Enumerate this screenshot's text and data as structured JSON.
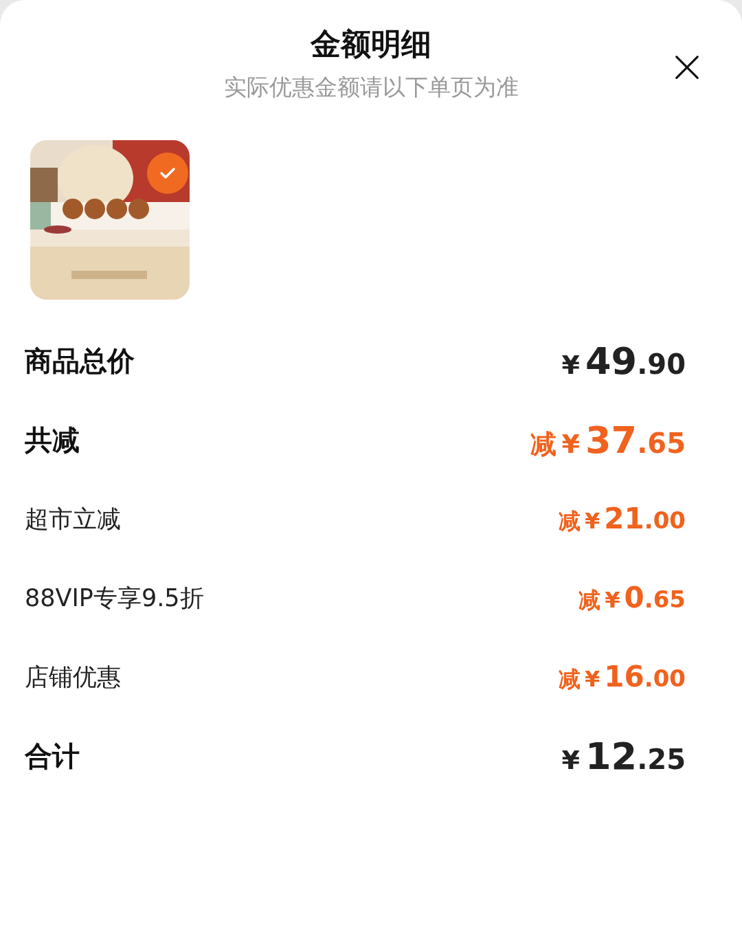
{
  "header": {
    "title": "金额明细",
    "subtitle": "实际优惠金额请以下单页为准"
  },
  "product": {
    "kind": "picture",
    "selected": true
  },
  "rows": [
    {
      "kind": "major",
      "label": "商品总价",
      "discount": false,
      "prefix": "",
      "currency": "¥",
      "integer": "49",
      "decimal": ".90"
    },
    {
      "kind": "major",
      "label": "共减",
      "discount": true,
      "prefix": "减",
      "currency": "¥",
      "integer": "37",
      "decimal": ".65"
    },
    {
      "kind": "minor",
      "label": "超市立减",
      "discount": true,
      "prefix": "减",
      "currency": "¥",
      "integer": "21",
      "decimal": ".00"
    },
    {
      "kind": "minor",
      "label": "88VIP专享9.5折",
      "discount": true,
      "prefix": "减",
      "currency": "¥",
      "integer": "0",
      "decimal": ".65"
    },
    {
      "kind": "minor",
      "label": "店铺优惠",
      "discount": true,
      "prefix": "减",
      "currency": "¥",
      "integer": "16",
      "decimal": ".00"
    },
    {
      "kind": "major",
      "label": "合计",
      "discount": false,
      "prefix": "",
      "currency": "¥",
      "integer": "12",
      "decimal": ".25"
    }
  ]
}
